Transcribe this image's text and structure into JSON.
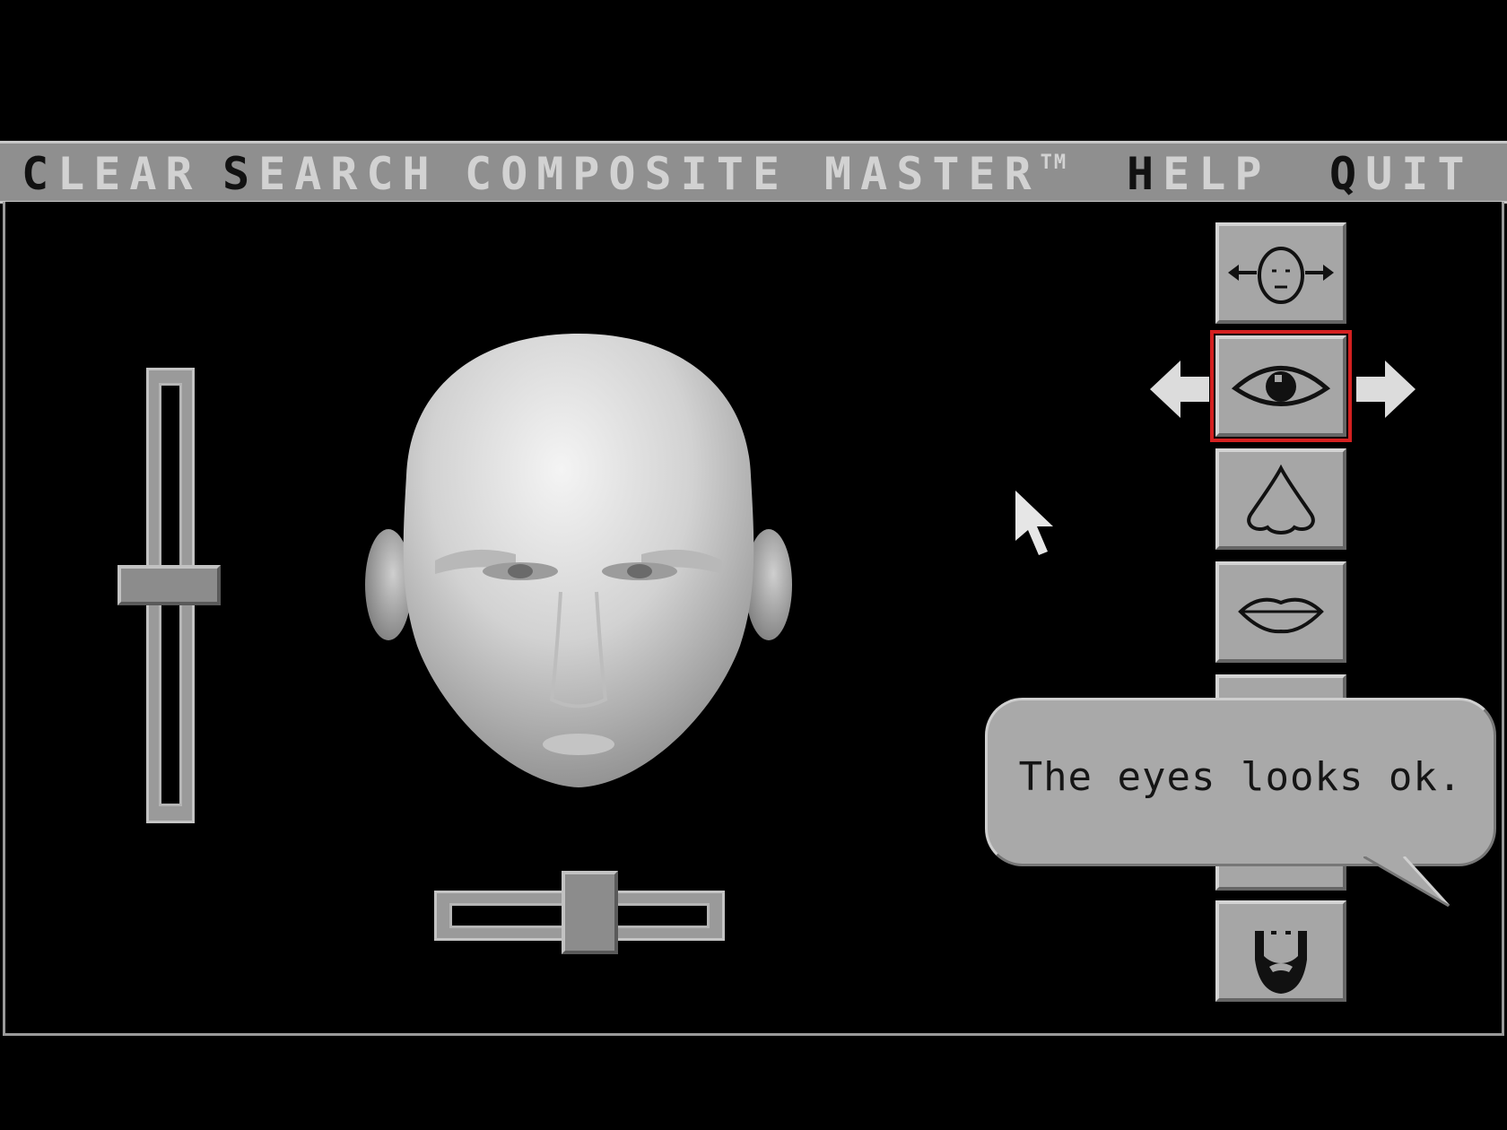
{
  "menu": {
    "clear": {
      "hot": "C",
      "rest": "LEAR"
    },
    "search": {
      "hot": "S",
      "rest": "EARCH"
    },
    "title": "COMPOSITE MASTER",
    "trademark": "TM",
    "help": {
      "hot": "H",
      "rest": "ELP"
    },
    "quit": {
      "hot": "Q",
      "rest": "UIT"
    }
  },
  "features": [
    "head-shape",
    "eyes",
    "nose",
    "mouth",
    "hidden",
    "extra",
    "beard"
  ],
  "selected_feature": "eyes",
  "bubble": {
    "text": "The eyes looks ok."
  },
  "sliders": {
    "vertical_level": 0.48,
    "horizontal_level": 0.55
  },
  "colors": {
    "background": "#000000",
    "panel": "#8f8f8f",
    "selection": "#d42020",
    "button": "#a6a6a6"
  }
}
